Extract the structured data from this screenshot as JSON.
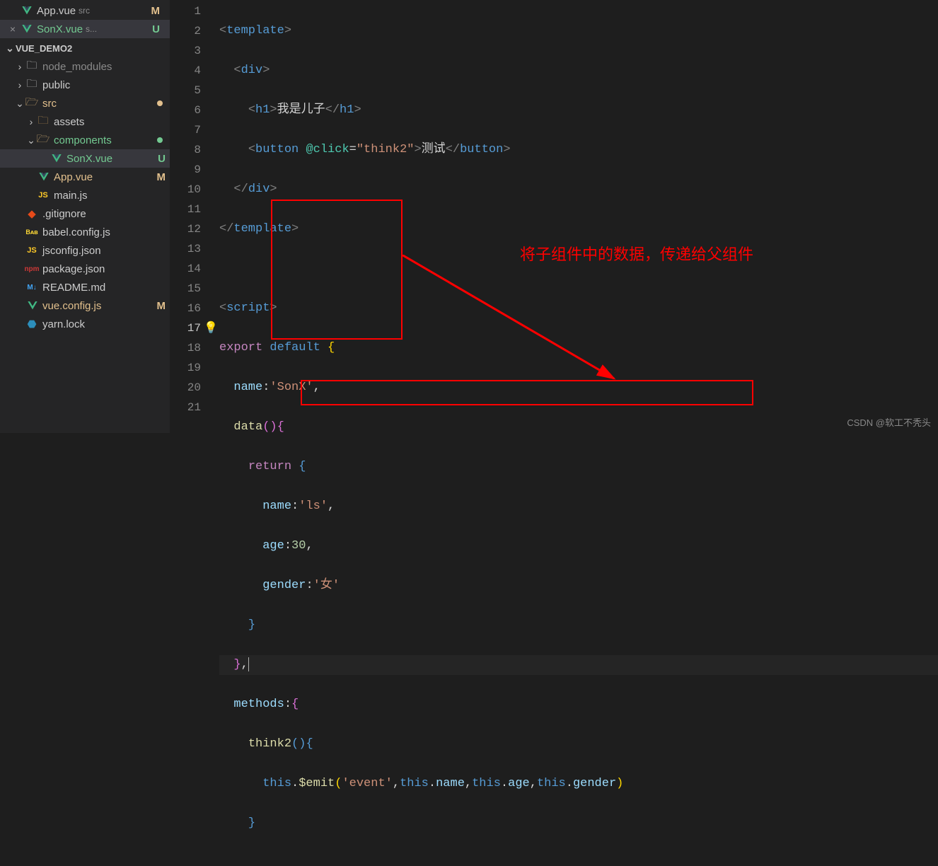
{
  "openEditors": [
    {
      "icon": "vue",
      "name": "App.vue",
      "desc": "src",
      "status": "M",
      "active": false,
      "close": ""
    },
    {
      "icon": "vue",
      "name": "SonX.vue",
      "desc": "s...",
      "status": "U",
      "active": true,
      "close": "×"
    }
  ],
  "explorer": {
    "title": "VUE_DEMO2",
    "tree": [
      {
        "indent": 1,
        "chev": "›",
        "icon": "node",
        "name": "node_modules",
        "status": "",
        "color": ""
      },
      {
        "indent": 1,
        "chev": "›",
        "icon": "public",
        "name": "public",
        "status": "",
        "color": ""
      },
      {
        "indent": 1,
        "chev": "⌄",
        "icon": "src",
        "name": "src",
        "status": "dot",
        "color": "dirty-M"
      },
      {
        "indent": 2,
        "chev": "›",
        "icon": "assets",
        "name": "assets",
        "status": "",
        "color": ""
      },
      {
        "indent": 2,
        "chev": "⌄",
        "icon": "comp",
        "name": "components",
        "status": "dot",
        "color": "dirty-U"
      },
      {
        "indent": 3,
        "chev": "",
        "icon": "vue",
        "name": "SonX.vue",
        "status": "U",
        "color": "dirty-U",
        "active": true
      },
      {
        "indent": 2,
        "chev": "",
        "icon": "vue",
        "name": "App.vue",
        "status": "M",
        "color": "dirty-M"
      },
      {
        "indent": 2,
        "chev": "",
        "icon": "js",
        "name": "main.js",
        "status": "",
        "color": ""
      },
      {
        "indent": 1,
        "chev": "",
        "icon": "git",
        "name": ".gitignore",
        "status": "",
        "color": ""
      },
      {
        "indent": 1,
        "chev": "",
        "icon": "babel",
        "name": "babel.config.js",
        "status": "",
        "color": ""
      },
      {
        "indent": 1,
        "chev": "",
        "icon": "jsconf",
        "name": "jsconfig.json",
        "status": "",
        "color": ""
      },
      {
        "indent": 1,
        "chev": "",
        "icon": "npm",
        "name": "package.json",
        "status": "",
        "color": ""
      },
      {
        "indent": 1,
        "chev": "",
        "icon": "md",
        "name": "README.md",
        "status": "",
        "color": ""
      },
      {
        "indent": 1,
        "chev": "",
        "icon": "vue",
        "name": "vue.config.js",
        "status": "M",
        "color": "dirty-M"
      },
      {
        "indent": 1,
        "chev": "",
        "icon": "yarn",
        "name": "yarn.lock",
        "status": "",
        "color": ""
      }
    ]
  },
  "annotation": "将子组件中的数据，传递给父组件",
  "watermark": "CSDN @软工不秃头",
  "code": {
    "lines": [
      "1",
      "2",
      "3",
      "4",
      "5",
      "6",
      "7",
      "8",
      "9",
      "10",
      "11",
      "12",
      "13",
      "14",
      "15",
      "16",
      "17",
      "18",
      "19",
      "20",
      "21"
    ],
    "text_h1": "我是儿子",
    "text_btn": "测试",
    "attr_click": "@click",
    "attr_val": "\"think2\"",
    "name_key": "name",
    "name_val": "'SonX'",
    "data_fn": "data",
    "return_kw": "return",
    "d_name": "name",
    "d_name_v": "'ls'",
    "d_age": "age",
    "d_age_v": "30",
    "d_gender": "gender",
    "d_gender_v": "'女'",
    "methods": "methods",
    "think2": "think2",
    "this": "this",
    "emit": "$emit",
    "evt": "'event'",
    "m_name": "name",
    "m_age": "age",
    "m_gender": "gender"
  }
}
